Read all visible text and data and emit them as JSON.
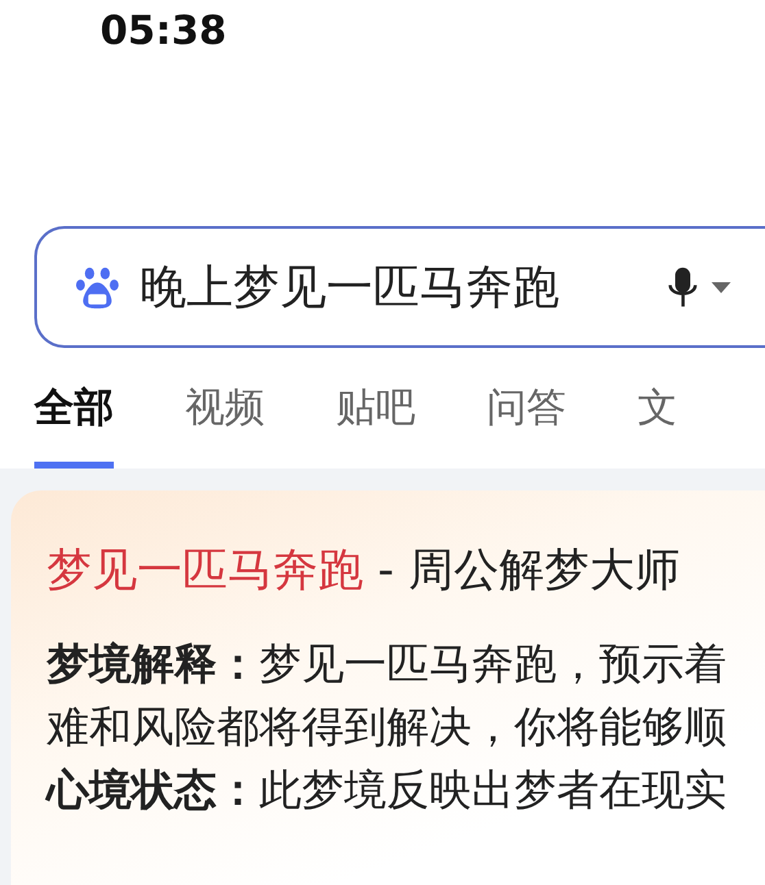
{
  "status_bar": {
    "time": "05:38"
  },
  "search": {
    "value": "晚上梦见一匹马奔跑"
  },
  "tabs": [
    {
      "label": "全部",
      "selected": true
    },
    {
      "label": "视频",
      "selected": false
    },
    {
      "label": "贴吧",
      "selected": false
    },
    {
      "label": "问答",
      "selected": false
    },
    {
      "label": "文",
      "selected": false
    }
  ],
  "result": {
    "title_highlight": "梦见一匹马奔跑",
    "title_rest": " - 周公解梦大师",
    "lines": [
      "**梦境解释：**梦见一匹马奔跑，预示着",
      "难和风险都将得到解决，你将能够顺",
      "**心境状态：**此梦境反映出梦者在现实"
    ]
  }
}
